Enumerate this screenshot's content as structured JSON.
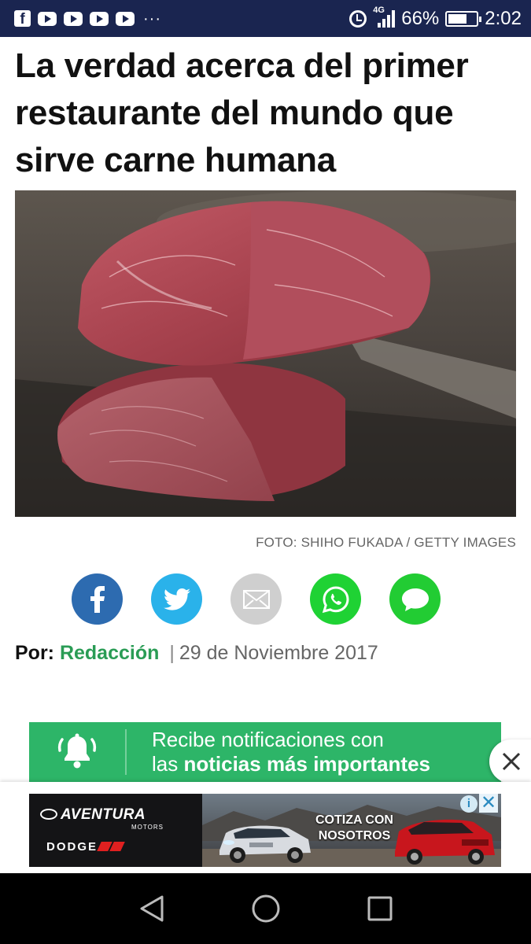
{
  "status_bar": {
    "battery_text": "66%",
    "time": "2:02",
    "network": "4G",
    "battery_level": 0.66,
    "icons": [
      "facebook-icon",
      "youtube-icon",
      "youtube-icon",
      "youtube-icon",
      "youtube-icon",
      "more-icon",
      "alarm-icon",
      "signal-icon",
      "battery-icon"
    ]
  },
  "article": {
    "headline": "La verdad acerca del primer restaurante del mundo que sirve carne humana",
    "photo_credit": "FOTO: SHIHO FUKADA / GETTY IMAGES",
    "byline_label": "Por:",
    "author": "Redacción",
    "separator": "|",
    "date": "29 de Noviembre 2017"
  },
  "share": {
    "buttons": [
      {
        "name": "facebook",
        "color": "#2d6bb0"
      },
      {
        "name": "twitter",
        "color": "#2ab2ea"
      },
      {
        "name": "email",
        "color": "#cfcfcf"
      },
      {
        "name": "whatsapp",
        "color": "#1fd234"
      },
      {
        "name": "message",
        "color": "#22cc33"
      }
    ]
  },
  "notification_banner": {
    "line1": "Recibe notificaciones con",
    "line2_prefix": "las ",
    "line2_bold": "noticias más importantes",
    "color": "#2db568"
  },
  "ad": {
    "brand": "AVENTURA",
    "brand_sub": "MOTORS",
    "make": "DODGE",
    "cta_line1": "COTIZA CON",
    "cta_line2": "NOSOTROS",
    "adchoices": "i",
    "close": "✕"
  },
  "nav_bar": {
    "buttons": [
      "back-icon",
      "home-icon",
      "recents-icon"
    ]
  }
}
